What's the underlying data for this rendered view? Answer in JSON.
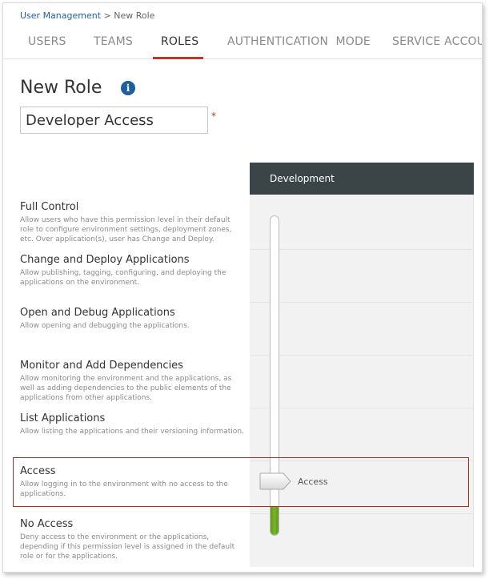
{
  "breadcrumb": {
    "parent": "User Management",
    "separator": ">",
    "current": "New Role"
  },
  "tabs": [
    {
      "label": "USERS",
      "active": false
    },
    {
      "label": "TEAMS",
      "active": false
    },
    {
      "label": "ROLES",
      "active": true
    },
    {
      "label": "AUTHENTICATION  MODE",
      "active": false
    },
    {
      "label": "SERVICE ACCOUNTS",
      "active": false
    }
  ],
  "page": {
    "title": "New Role",
    "info_icon": "info-icon"
  },
  "role_name": {
    "value": "Developer Access",
    "required_mark": "*"
  },
  "environment_column": {
    "header": "Development"
  },
  "permission_levels": [
    {
      "title": "Full Control",
      "description": "Allow users who have this permission level in their default role to configure environment settings, deployment zones, etc. Over application(s), user has Change and Deploy."
    },
    {
      "title": "Change and Deploy Applications",
      "description": "Allow publishing, tagging, configuring, and deploying the applications on the environment."
    },
    {
      "title": "Open and Debug Applications",
      "description": "Allow opening and debugging the applications."
    },
    {
      "title": "Monitor and Add Dependencies",
      "description": "Allow monitoring the environment and the applications, as well as adding dependencies to the public elements of the applications from other applications."
    },
    {
      "title": "List Applications",
      "description": "Allow listing the applications and their versioning information."
    },
    {
      "title": "Access",
      "description": "Allow logging in to the environment with no access to the applications."
    },
    {
      "title": "No Access",
      "description": "Deny access to the environment or the applications, depending if this permission level is assigned in the default role or for the applications."
    }
  ],
  "slider": {
    "selected_label": "Access",
    "selected_index": 5,
    "levels_total": 7,
    "fill_color": "#7ab32e"
  },
  "colors": {
    "accent_red": "#b73a2a",
    "link_blue": "#1f5e9f",
    "header_dark": "#3b4446"
  }
}
